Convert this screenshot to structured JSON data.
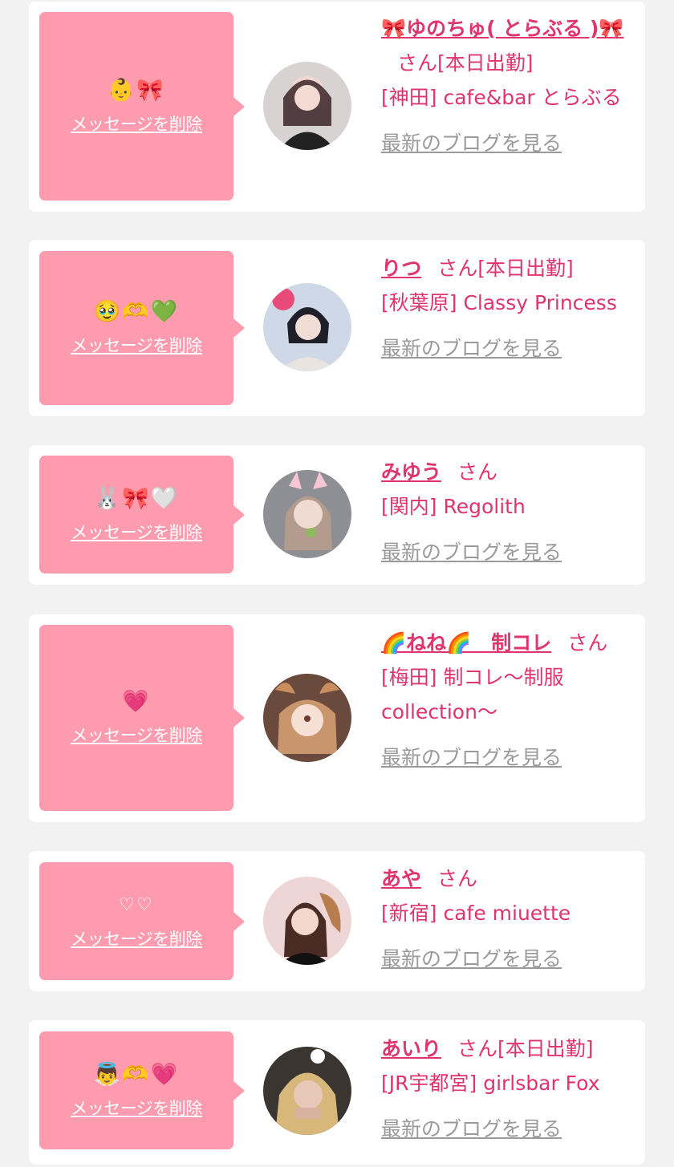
{
  "delete_label": "メッセージを削除",
  "blog_label": "最新のブログを見る",
  "san_label": "さん",
  "colors": {
    "accent": "#e0346c",
    "bubble": "#ff9bae",
    "background": "#f2f2f2"
  },
  "cards": [
    {
      "emoji": "👶🎀",
      "name": "🎀ゆのちゅ( とらぶる )🎀",
      "badge": "[本日出勤]",
      "shop": "[神田] cafe&bar とらぶる"
    },
    {
      "emoji": "🥹🫶💚",
      "name": "りつ",
      "badge": "[本日出勤]",
      "shop": "[秋葉原] Classy Princess"
    },
    {
      "emoji": "🐰🎀🤍",
      "name": "みゆう",
      "badge": "",
      "shop": "[関内] Regolith"
    },
    {
      "emoji": "💗",
      "name": "🌈ねね🌈　制コレ",
      "badge": "",
      "shop": "[梅田] 制コレ〜制服collection〜"
    },
    {
      "emoji": "♡♡",
      "name": "あや",
      "badge": "",
      "shop": "[新宿] cafe miuette"
    },
    {
      "emoji": "👼🫶💗",
      "name": "あいり",
      "badge": "[本日出勤]",
      "shop": "[JR宇都宮] girlsbar Fox"
    }
  ]
}
